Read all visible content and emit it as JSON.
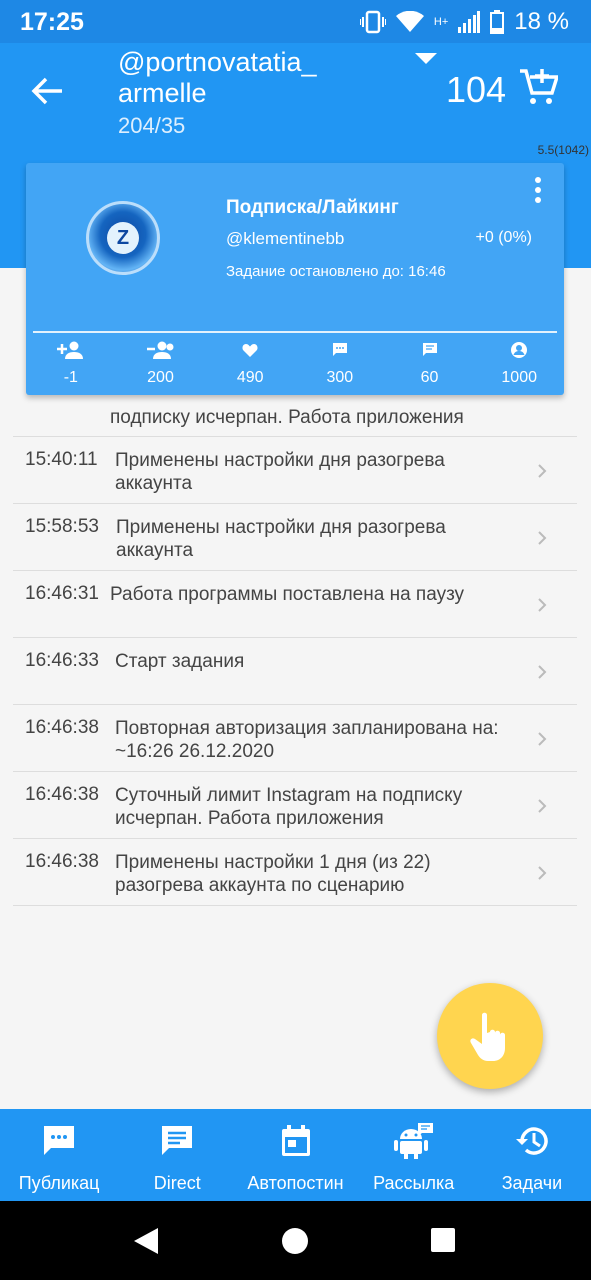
{
  "status_bar": {
    "time": "17:25",
    "network": "H+",
    "battery": "18 %"
  },
  "header": {
    "account": "@portnovatatia_armelle",
    "counts": "204/35",
    "credits": "104",
    "version": "5.5(1042)"
  },
  "task_card": {
    "title": "Подписка/Лайкинг",
    "handle": "@klementinebb",
    "delta": "+0 (0%)",
    "status": "Задание остановлено до: 16:46",
    "stats": [
      {
        "icon": "follow-icon",
        "value": "-1"
      },
      {
        "icon": "unfollow-icon",
        "value": "200"
      },
      {
        "icon": "heart-icon",
        "value": "490"
      },
      {
        "icon": "comment-icon",
        "value": "300"
      },
      {
        "icon": "message-icon",
        "value": "60"
      },
      {
        "icon": "profile-icon",
        "value": "1000"
      }
    ]
  },
  "log": {
    "partial": "подписку исчерпан. Работа приложения",
    "entries": [
      {
        "time": "15:40:11",
        "message": "Применены настройки дня разогрева аккаунта"
      },
      {
        "time": "15:58:53",
        "message": "Применены настройки дня разогрева аккаунта"
      },
      {
        "time": "16:46:31",
        "message": "Работа программы поставлена на паузу"
      },
      {
        "time": "16:46:33",
        "message": "Старт задания"
      },
      {
        "time": "16:46:38",
        "message": "Повторная авторизация запланирована на: ~16:26 26.12.2020"
      },
      {
        "time": "16:46:38",
        "message": "Суточный лимит Instagram на подписку исчерпан. Работа приложения"
      },
      {
        "time": "16:46:38",
        "message": "Применены настройки 1 дня (из 22) разогрева аккаунта по сценарию"
      }
    ]
  },
  "bottom_nav": [
    {
      "label": "Публикац",
      "icon": "chat-bubble-icon"
    },
    {
      "label": "Direct",
      "icon": "message-icon"
    },
    {
      "label": "Автопостин",
      "icon": "calendar-icon"
    },
    {
      "label": "Рассылка",
      "icon": "android-icon"
    },
    {
      "label": "Задачи",
      "icon": "history-icon"
    }
  ],
  "colors": {
    "primary": "#2196f3",
    "card": "#42a5f5",
    "fab": "#ffd54f"
  }
}
